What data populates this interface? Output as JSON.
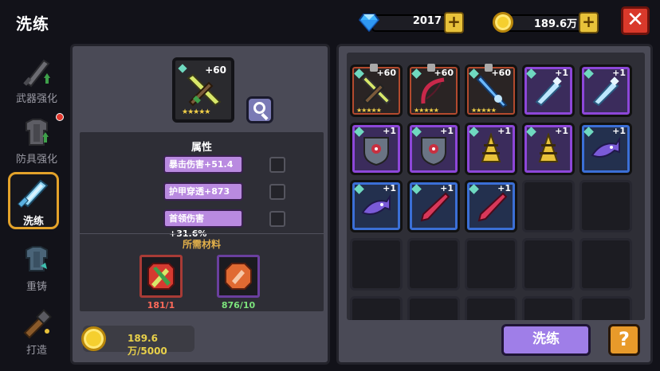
{
  "header": {
    "title": "洗练",
    "gems": "2017",
    "gold": "189.6万",
    "gem_plus": "+",
    "gold_plus": "+",
    "close": "✕"
  },
  "sidebar": {
    "items": [
      {
        "label": "武器强化",
        "icon": "sword-upgrade-icon"
      },
      {
        "label": "防具强化",
        "icon": "armor-upgrade-icon"
      },
      {
        "label": "洗练",
        "icon": "refine-sword-icon",
        "active": true
      },
      {
        "label": "重铸",
        "icon": "recast-armor-icon"
      },
      {
        "label": "打造",
        "icon": "forge-icon"
      }
    ]
  },
  "selected": {
    "level": "+60",
    "stars": "★★★★★"
  },
  "attributes": {
    "title": "属性",
    "rows": [
      "暴击伤害+51.4",
      "护甲穿透+873",
      "首领伤害+31.6%"
    ]
  },
  "materials": {
    "title": "所需材料",
    "items": [
      {
        "count": "181/1",
        "color": "#ff6a5a"
      },
      {
        "count": "876/10",
        "color": "#7ce37c"
      }
    ]
  },
  "cost": {
    "value": "189.6万/5000"
  },
  "inventory": {
    "slots": [
      {
        "rarity": "orange",
        "plus": "+60",
        "stars": "★★★★★",
        "locked": true,
        "item": "crossed-sword-icon"
      },
      {
        "rarity": "orange",
        "plus": "+60",
        "stars": "★★★★★",
        "locked": true,
        "item": "bow-icon"
      },
      {
        "rarity": "orange",
        "plus": "+60",
        "stars": "★★★★★",
        "locked": true,
        "item": "lightning-spear-icon"
      },
      {
        "rarity": "purple",
        "plus": "+1",
        "item": "ice-sword-icon"
      },
      {
        "rarity": "purple",
        "plus": "+1",
        "item": "ice-sword-icon"
      },
      {
        "rarity": "purple",
        "plus": "+1",
        "item": "shield-icon"
      },
      {
        "rarity": "purple",
        "plus": "+1",
        "item": "shield-icon"
      },
      {
        "rarity": "purple",
        "plus": "+1",
        "item": "drill-icon"
      },
      {
        "rarity": "purple",
        "plus": "+1",
        "item": "drill-icon"
      },
      {
        "rarity": "blue",
        "plus": "+1",
        "item": "fish-icon"
      },
      {
        "rarity": "blue",
        "plus": "+1",
        "item": "fish-icon"
      },
      {
        "rarity": "blue",
        "plus": "+1",
        "item": "lance-icon"
      },
      {
        "rarity": "blue",
        "plus": "+1",
        "item": "lance-icon"
      }
    ]
  },
  "buttons": {
    "refine": "洗练",
    "help": "?"
  }
}
